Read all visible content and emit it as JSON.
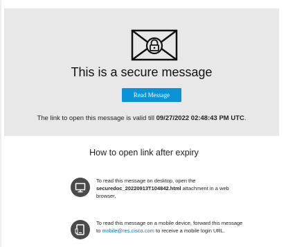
{
  "message": {
    "title": "This is a secure message",
    "read_button_label": "Read Message",
    "validity_prefix": "The link to open this message is valid till ",
    "validity_date": "09/27/2022 02:48:43 PM UTC",
    "validity_suffix": "."
  },
  "expiry": {
    "heading": "How to open link after expiry",
    "desktop": {
      "icon": "monitor-icon",
      "text_prefix": "To read this message on desktop, open the ",
      "attachment_name": "securedoc_20220913T104842.html",
      "text_suffix": " attachment in a web browser."
    },
    "mobile": {
      "icon": "mobile-device-icon",
      "text_prefix": "To read this message on a mobile device, forward this message to ",
      "email": "mobile@res.cisco.com",
      "text_suffix": " to receive a mobile login URL."
    }
  },
  "colors": {
    "header_background": "#e8e8e8",
    "button_background": "#0b93d8",
    "link": "#0b74c4",
    "icon_circle": "#4a4a4a"
  }
}
